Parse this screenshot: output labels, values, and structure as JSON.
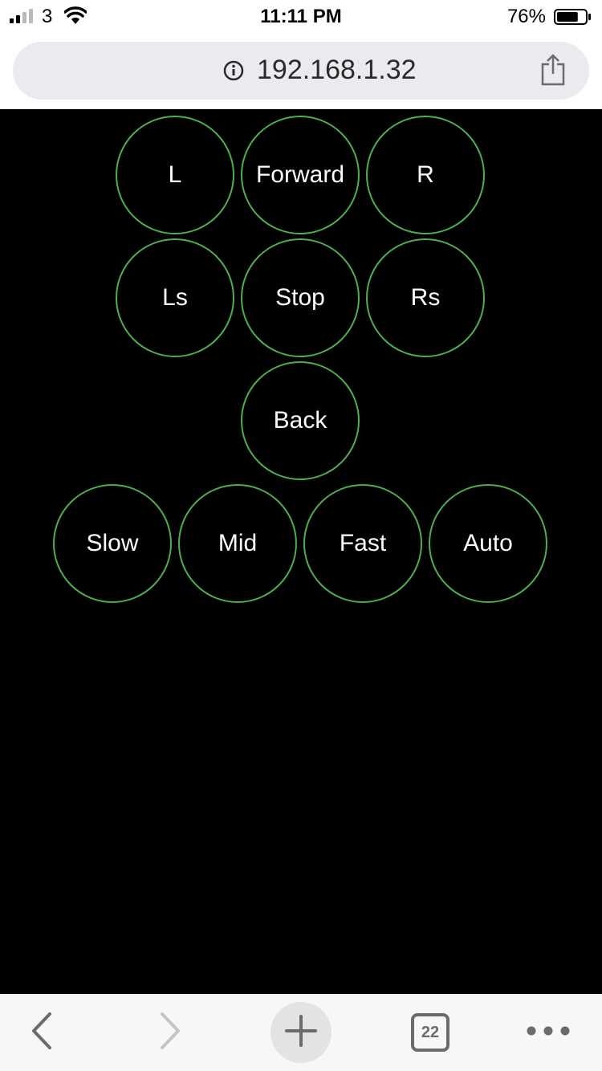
{
  "status_bar": {
    "carrier": "3",
    "time": "11:11 PM",
    "battery_percent": "76%",
    "battery_level": 0.76
  },
  "browser": {
    "url": "192.168.1.32",
    "tab_count": "22"
  },
  "controls": {
    "L": "L",
    "forward": "Forward",
    "R": "R",
    "Ls": "Ls",
    "stop": "Stop",
    "Rs": "Rs",
    "back": "Back",
    "slow": "Slow",
    "mid": "Mid",
    "fast": "Fast",
    "auto": "Auto"
  },
  "colors": {
    "background": "#000000",
    "button_border": "#4caf50",
    "button_text": "#ffffff"
  },
  "icons": {
    "signal": "cellular-signal-icon",
    "wifi": "wifi-icon",
    "battery": "battery-icon",
    "info": "info-icon",
    "share": "share-icon",
    "back": "chevron-left-icon",
    "forward": "chevron-right-icon",
    "new_tab": "plus-icon",
    "tabs": "tab-switcher-icon",
    "menu": "more-dots-icon"
  }
}
